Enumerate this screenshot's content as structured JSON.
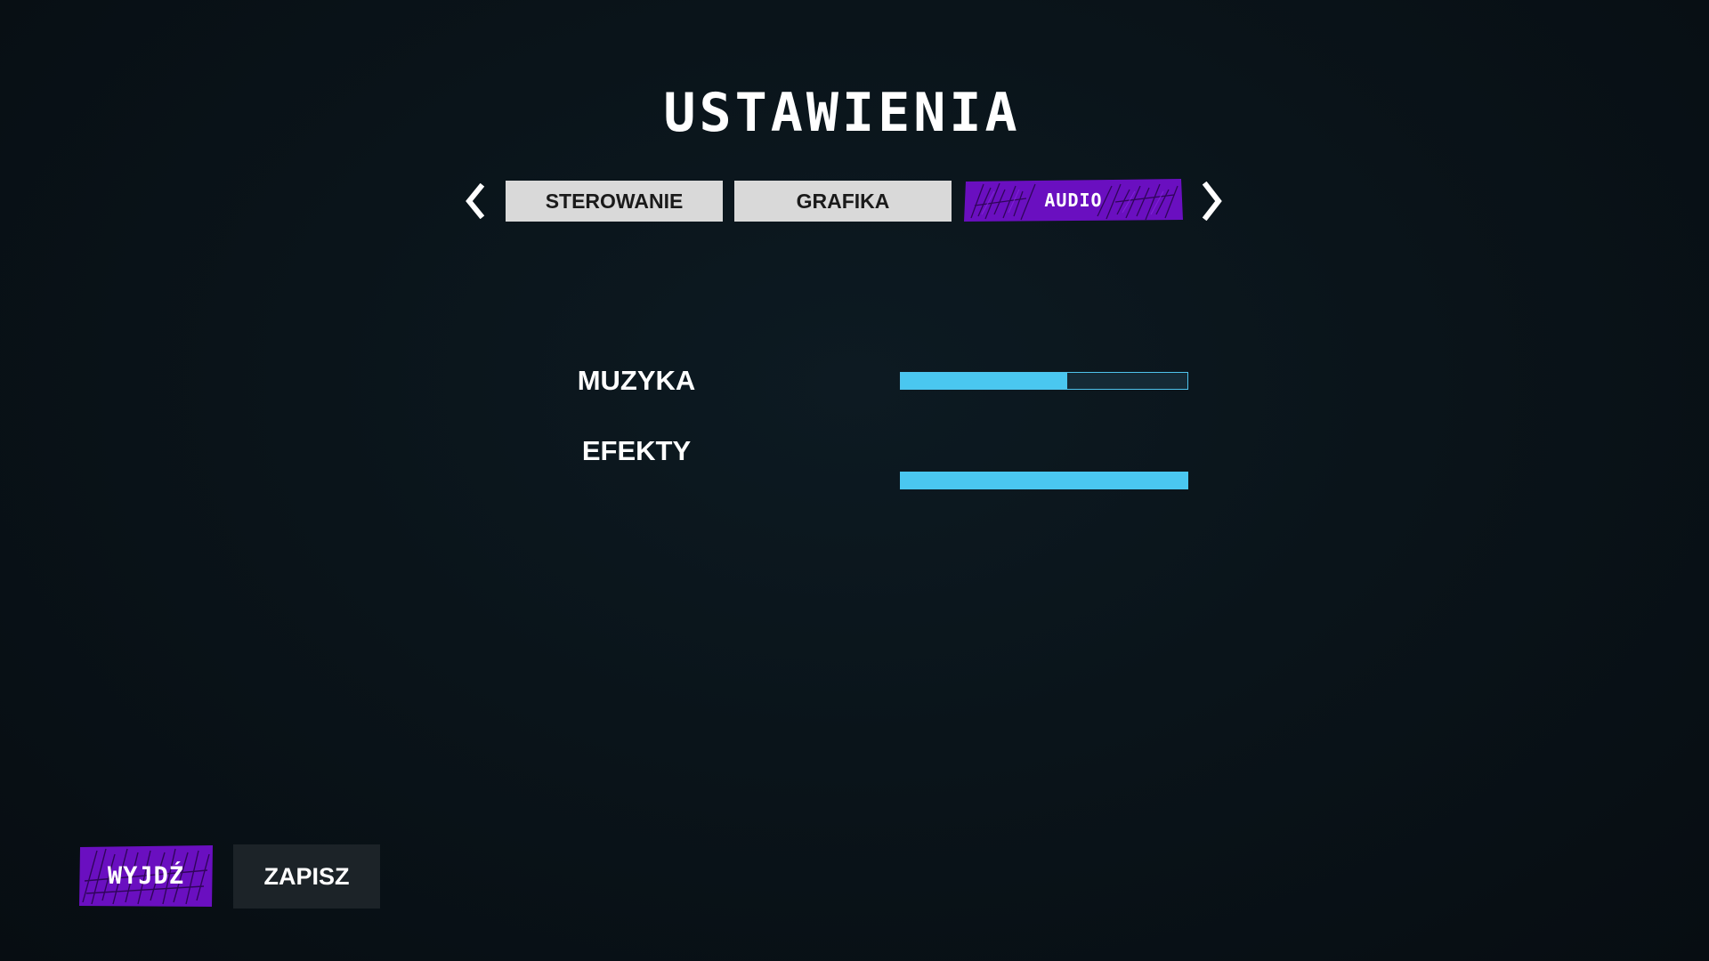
{
  "screen": {
    "title": "USTAWIENIA"
  },
  "tabs": [
    {
      "label": "STEROWANIE",
      "active": false
    },
    {
      "label": "GRAFIKA",
      "active": false
    },
    {
      "label": "AUDIO",
      "active": true
    }
  ],
  "nav": {
    "prev_icon": "chevron-left-icon",
    "next_icon": "chevron-right-icon"
  },
  "settings": {
    "music": {
      "label": "MUZYKA",
      "value_percent": 58
    },
    "effects": {
      "label": "EFEKTY",
      "value_percent": 100
    }
  },
  "footer": {
    "exit_label": "WYJDŹ",
    "save_label": "ZAPISZ"
  },
  "colors": {
    "background": "#0a141a",
    "accent_purple": "#6a0fc0",
    "slider_fill": "#4ac7f0",
    "tab_inactive": "#d9d9d9"
  }
}
